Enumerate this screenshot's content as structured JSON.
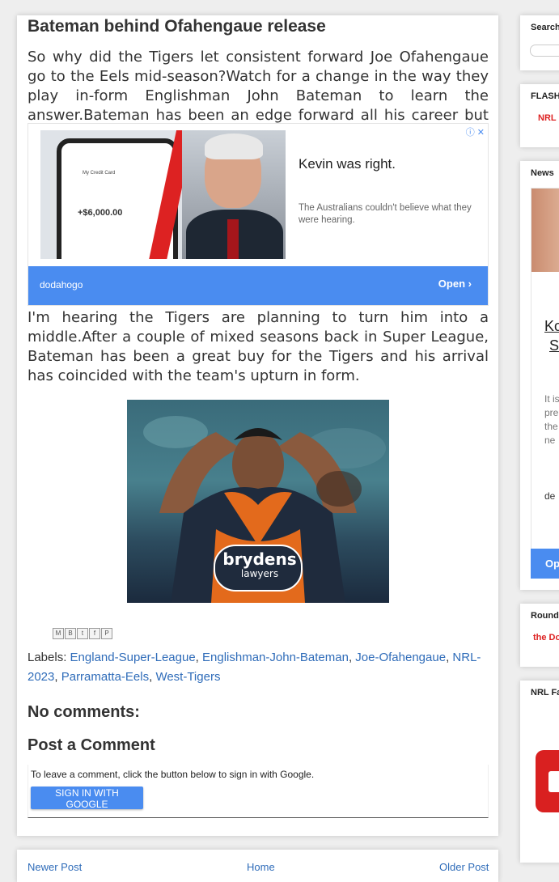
{
  "post": {
    "title": "Bateman behind Ofahengaue release",
    "para1": "So why did the Tigers let consistent forward Joe Ofahengaue go to the Eels mid-season?Watch for a change in the way they play in-form Englishman John Bateman to learn the answer.Bateman has been an edge forward all his career but",
    "para2": "I'm hearing the Tigers are planning to turn him into a middle.After a couple of mixed seasons back in Super League, Bateman has been a great buy for the Tigers and his arrival has coincided with the team's upturn in form."
  },
  "ad": {
    "headline": "Kevin was right.",
    "description": "The Australians couldn't believe what they were hearing.",
    "source": "dodahogo",
    "open_label": "Open",
    "open_chevron": "›",
    "adchoices": "ⓘ ✕",
    "phone_header": "My Credit Card",
    "phone_balance": "+$6,000.00"
  },
  "image": {
    "sponsor_line1": "brydens",
    "sponsor_line2": "lawyers"
  },
  "share_icons": [
    "M",
    "B",
    "t",
    "f",
    "P"
  ],
  "labels": {
    "prefix": "Labels:",
    "items": [
      "England-Super-League",
      "Englishman-John-Bateman",
      "Joe-Ofahengaue",
      "NRL-2023",
      "Parramatta-Eels",
      "West-Tigers"
    ]
  },
  "comments": {
    "no_comments": "No comments:",
    "post_heading": "Post a Comment",
    "note": "To leave a comment, click the button below to sign in with Google.",
    "button": "SIGN IN WITH GOOGLE"
  },
  "nav": {
    "newer": "Newer Post",
    "home": "Home",
    "older": "Older Post"
  },
  "sidebar": {
    "search_title": "Search",
    "flash_title": "FLASH",
    "flash_item": "NRL",
    "news_title": "News",
    "news_text1": "Ko",
    "news_text2": "S",
    "news_body": [
      "It is",
      "pre",
      "the",
      "ne"
    ],
    "news_extra": "de",
    "news_button": "Op",
    "round_title": "Round",
    "round_item": "the Do",
    "fa_title": "NRL Fa"
  }
}
